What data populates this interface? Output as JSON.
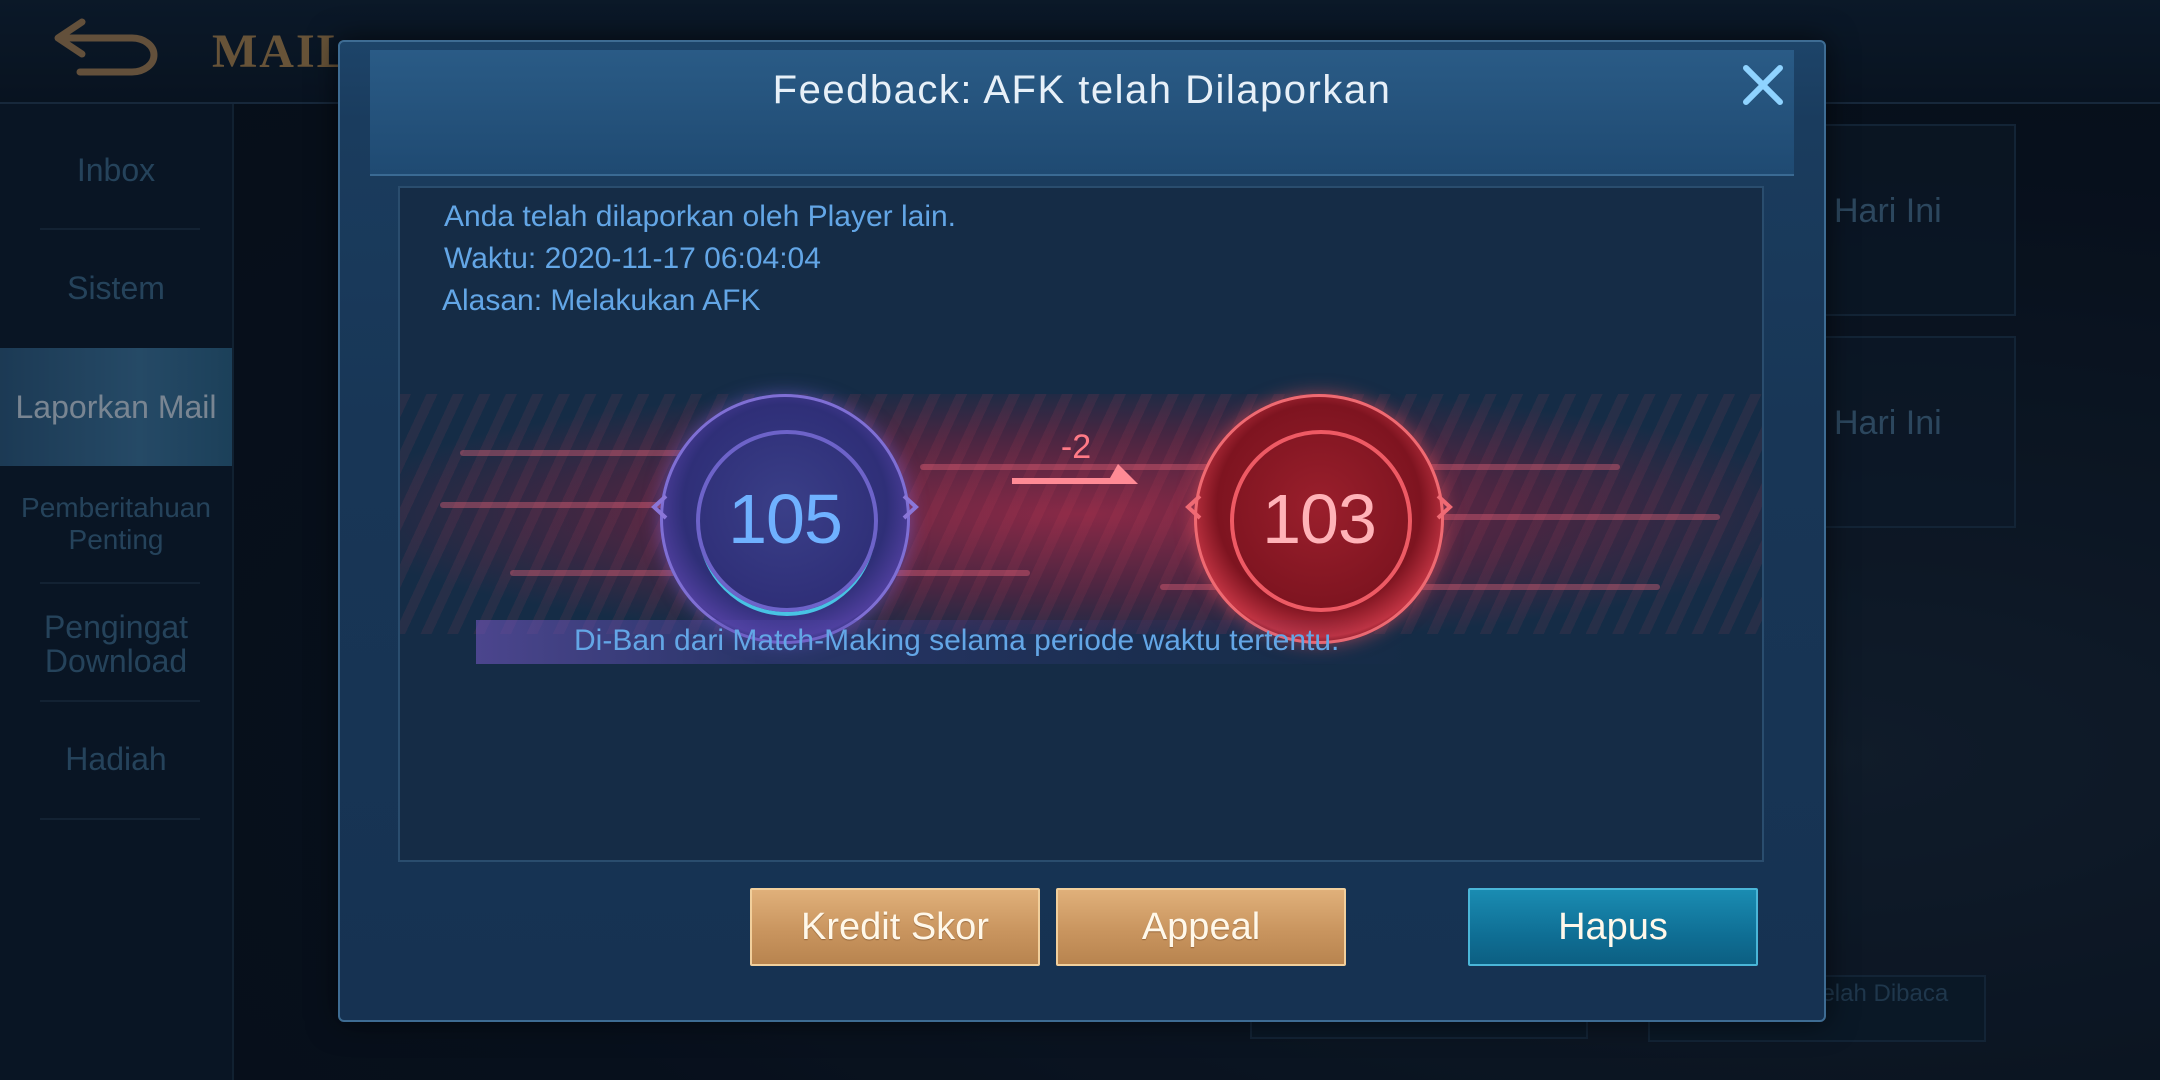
{
  "background": {
    "title": "MAIL",
    "sidebar": [
      {
        "label": "Inbox"
      },
      {
        "label": "Sistem"
      },
      {
        "label": "Laporkan Mail",
        "active": true
      },
      {
        "label": "Pemberitahuan Penting"
      },
      {
        "label": "Pengingat Download"
      },
      {
        "label": "Hadiah"
      }
    ],
    "list_items": [
      {
        "label": "Hari Ini"
      },
      {
        "label": "Hari Ini"
      }
    ],
    "bottom_buttons": [
      {
        "label": ""
      },
      {
        "label": "ua sebagai Telah Dibaca"
      }
    ]
  },
  "dialog": {
    "title": "Feedback: AFK telah Dilaporkan",
    "message_line1": "Anda telah dilaporkan oleh Player lain.",
    "message_line2": "Waktu: 2020-11-17 06:04:04",
    "message_line3": "Alasan: Melakukan AFK",
    "score_before": "105",
    "score_change": "-2",
    "score_after": "103",
    "ban_notice": "Di-Ban dari Match-Making selama periode waktu tertentu.",
    "buttons": {
      "credit_score": "Kredit Skor",
      "appeal": "Appeal",
      "delete": "Hapus"
    }
  },
  "colors": {
    "accent_blue": "#63a6e6",
    "score_old": "#6fb1ff",
    "score_new_bg": "#9a1f2c",
    "button_gold": "#c9955f",
    "button_blue": "#0f6f95"
  },
  "icons": [
    "back-arrow-icon",
    "close-icon",
    "decrease-arrow-icon"
  ]
}
